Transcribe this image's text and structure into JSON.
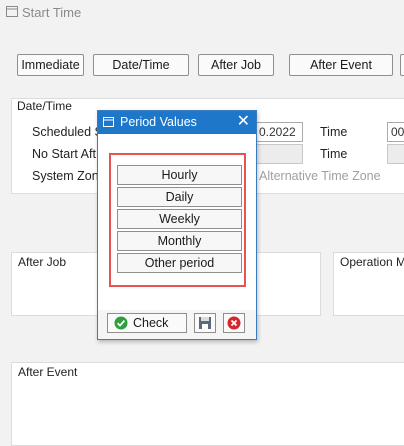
{
  "window": {
    "title": "Start Time"
  },
  "toolbar": {
    "immediate": "Immediate",
    "date_time": "Date/Time",
    "after_job": "After Job",
    "after_event": "After Event"
  },
  "date_time_group": {
    "title": "Date/Time",
    "scheduled_label": "Scheduled S",
    "scheduled_date_value": "0.2022",
    "time_label": "Time",
    "time_value": "00",
    "no_start_label": "No Start Aft",
    "time_label_2": "Time",
    "system_zone_label": "System Zon",
    "alt_time_zone_label": "Alternative Time Zone"
  },
  "after_job_group": {
    "title": "After Job"
  },
  "operation_group": {
    "title": "Operation M"
  },
  "after_event_group": {
    "title": "After Event"
  },
  "dialog": {
    "title": "Period Values",
    "close": "✕",
    "periods": [
      "Hourly",
      "Daily",
      "Weekly",
      "Monthly",
      "Other period"
    ],
    "check_label": "Check"
  },
  "colors": {
    "dialog_header": "#1f77c9",
    "highlight_border": "#e8534f",
    "check_icon": "#2e9e3e",
    "cancel_icon": "#d6262d"
  },
  "icons": [
    "window-icon",
    "dialog-window-icon",
    "close-icon",
    "check-icon",
    "save-icon",
    "cancel-icon",
    "checkbox"
  ]
}
